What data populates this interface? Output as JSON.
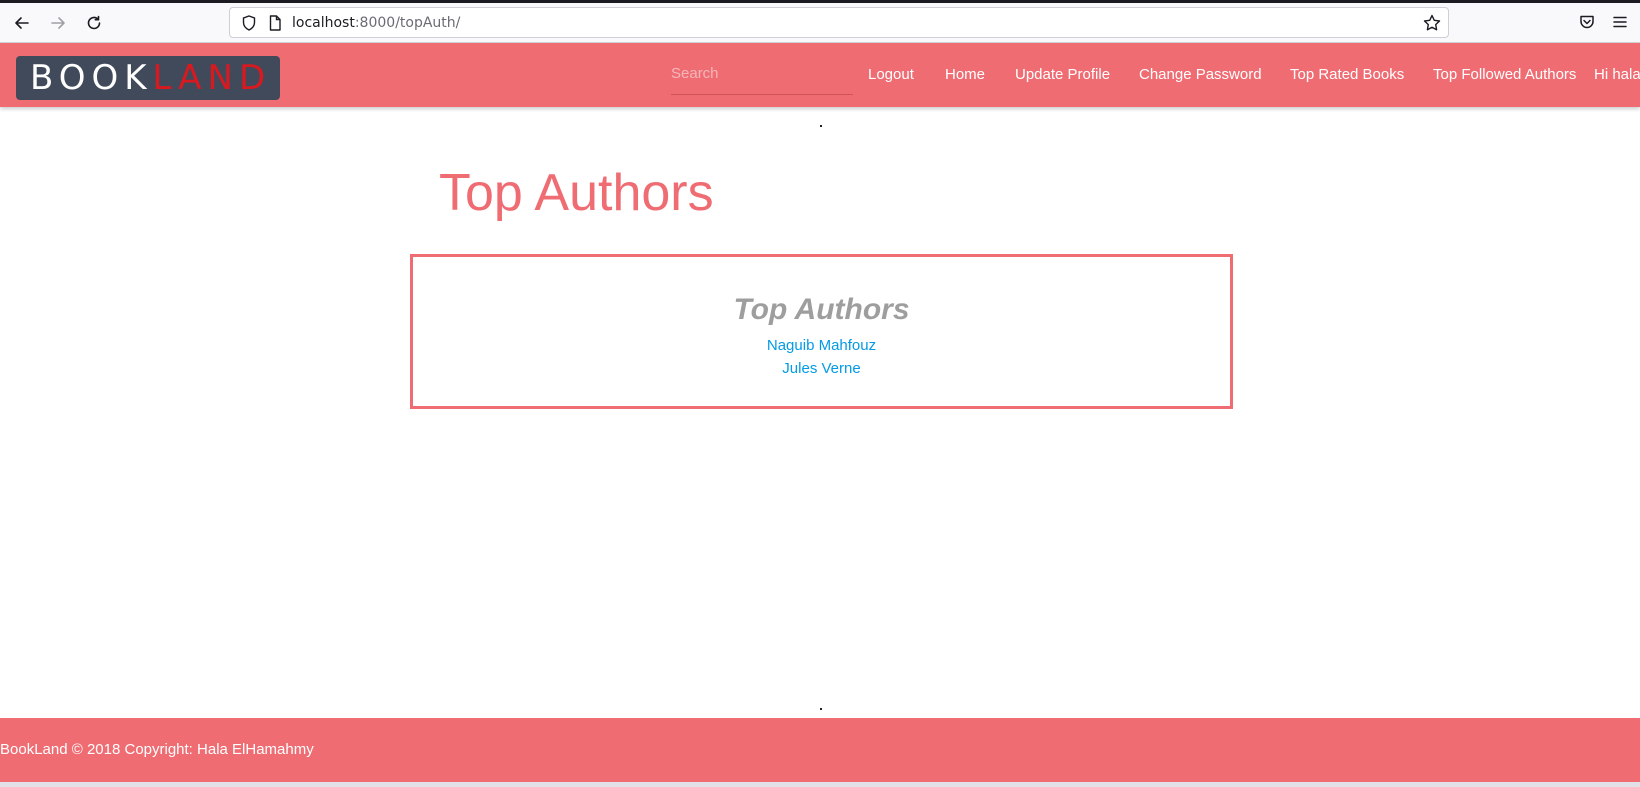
{
  "browser": {
    "url_host": "localhost",
    "url_path": ":8000/topAuth/"
  },
  "navbar": {
    "logo_part1": "BOOK",
    "logo_part2": "LAND",
    "search_placeholder": "Search",
    "links": [
      {
        "label": "Logout"
      },
      {
        "label": "Home"
      },
      {
        "label": "Update Profile"
      },
      {
        "label": "Change Password"
      },
      {
        "label": "Top Rated Books"
      },
      {
        "label": "Top Followed Authors"
      },
      {
        "label": "Hi hala"
      }
    ]
  },
  "main": {
    "title": "Top Authors",
    "card": {
      "heading": "Top Authors",
      "authors": [
        "Naguib Mahfouz",
        "Jules Verne"
      ]
    }
  },
  "footer": {
    "text": "BookLand © 2018 Copyright: Hala ElHamahmy"
  },
  "colors": {
    "brand": "#ef6c73",
    "link": "#039be5",
    "logo_bg": "#414a5b",
    "logo_accent": "#d8191f"
  }
}
